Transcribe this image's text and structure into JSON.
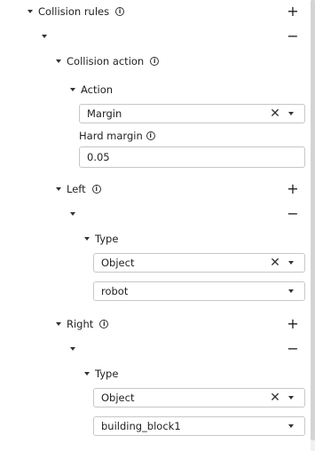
{
  "collision_rules": {
    "label": "Collision rules",
    "add_symbol": "+",
    "item_remove_symbol": "−",
    "collision_action": {
      "label": "Collision action",
      "action": {
        "label": "Action",
        "selected": "Margin",
        "clear_symbol": "✕"
      },
      "hard_margin": {
        "label": "Hard margin",
        "value": "0.05"
      }
    },
    "left": {
      "label": "Left",
      "add_symbol": "+",
      "item_remove_symbol": "−",
      "type": {
        "label": "Type",
        "selected": "Object",
        "clear_symbol": "✕",
        "object_value": "robot"
      }
    },
    "right": {
      "label": "Right",
      "add_symbol": "+",
      "item_remove_symbol": "−",
      "type": {
        "label": "Type",
        "selected": "Object",
        "clear_symbol": "✕",
        "object_value": "building_block1"
      }
    }
  },
  "info_icon_glyph": "i"
}
